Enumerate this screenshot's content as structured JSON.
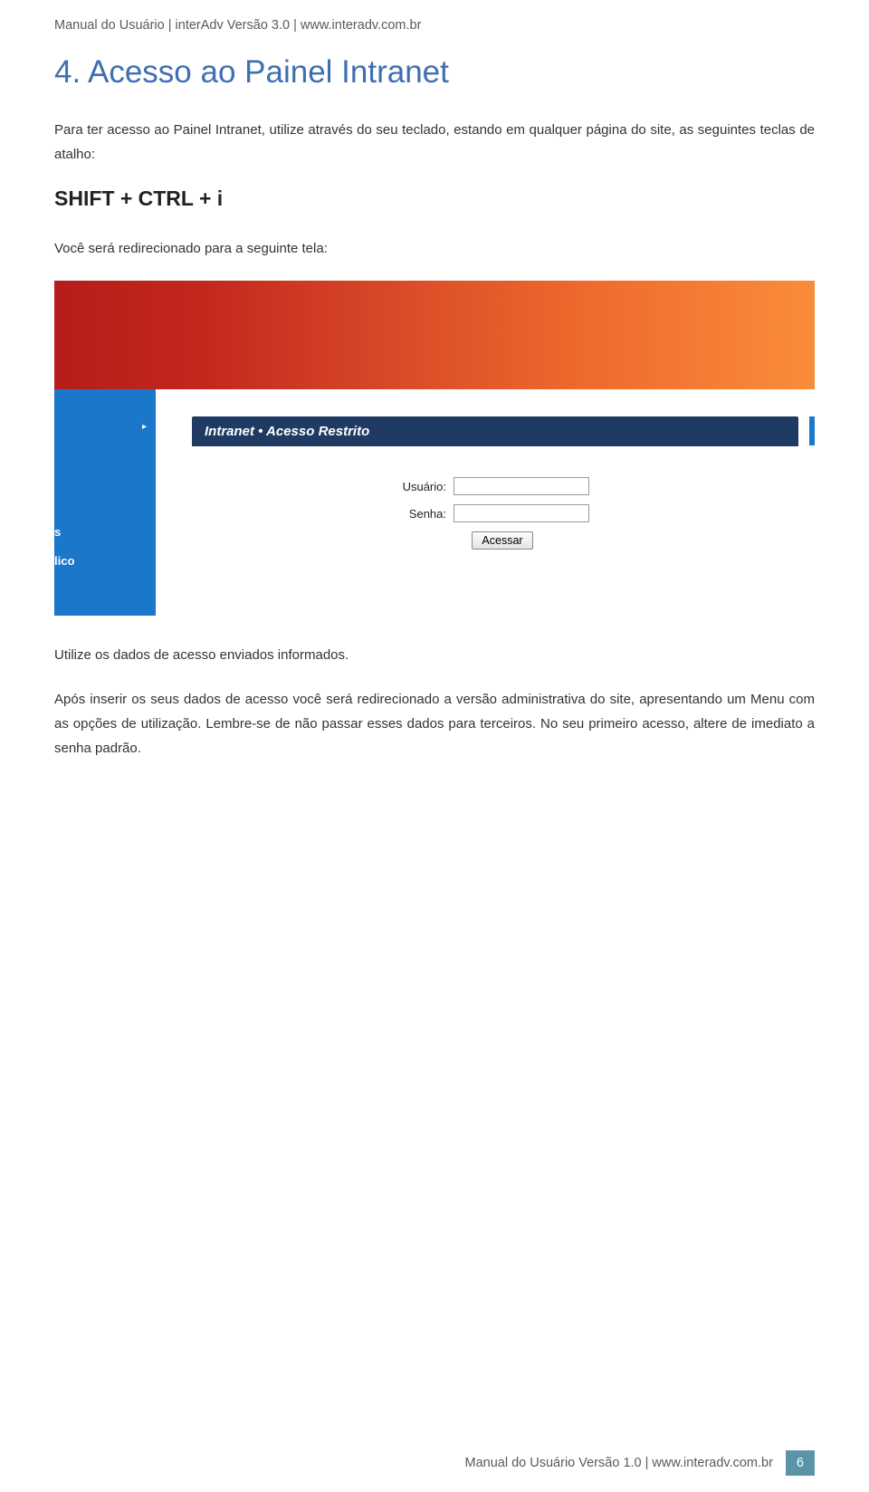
{
  "header": {
    "line": "Manual do Usuário | interAdv Versão 3.0 | www.interadv.com.br"
  },
  "title": "4.  Acesso ao Painel Intranet",
  "intro": "Para ter acesso ao Painel Intranet, utilize através do seu teclado, estando em qualquer página do site, as seguintes teclas de atalho:",
  "shortcut": "SHIFT + CTRL + i",
  "redirect": "Você será redirecionado para a seguinte tela:",
  "screenshot": {
    "panel_title": "Intranet • Acesso Restrito",
    "label_user": "Usuário:",
    "label_pass": "Senha:",
    "button": "Acessar",
    "sidebar_frag1": "s",
    "sidebar_frag2": "lico",
    "arrow": "▸"
  },
  "after1": "Utilize os dados de acesso enviados informados.",
  "after2": "Após inserir os seus dados de acesso você será redirecionado a versão administrativa do site, apresentando um Menu com as opções de utilização. Lembre-se de não passar esses dados para terceiros. No seu primeiro acesso, altere de imediato a senha padrão.",
  "footer": {
    "text": "Manual do Usuário Versão 1.0 | www.interadv.com.br",
    "page": "6"
  }
}
